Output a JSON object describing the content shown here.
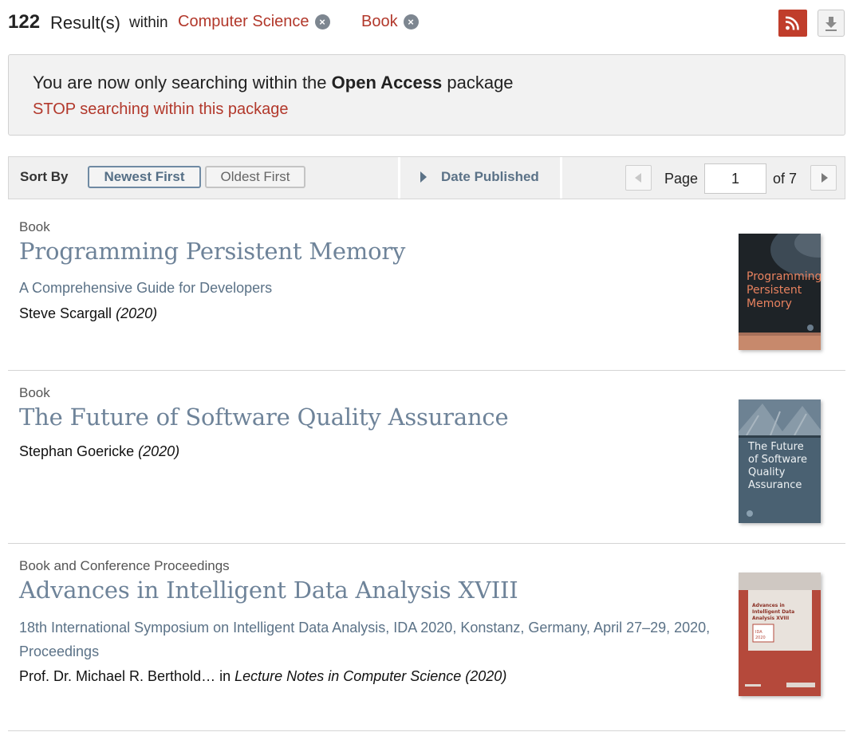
{
  "header": {
    "count": "122",
    "results_label": "Result(s)",
    "within_label": "within",
    "facets": [
      {
        "label": "Computer Science"
      },
      {
        "label": "Book"
      }
    ],
    "remove_symbol": "×",
    "rss_icon": "rss-icon",
    "download_icon": "download-icon"
  },
  "notice": {
    "prefix": "You are now only searching within the ",
    "package_name": "Open Access",
    "suffix": " package",
    "stop_link": "STOP searching within this package"
  },
  "toolbar": {
    "sort_label": "Sort By",
    "newest": "Newest First",
    "oldest": "Oldest First",
    "date_published": "Date Published",
    "page_label": "Page",
    "page_value": "1",
    "page_of": "of 7"
  },
  "results": [
    {
      "type": "Book",
      "title": "Programming Persistent Memory",
      "subtitle": "A Comprehensive Guide for Developers",
      "authors": "Steve Scargall",
      "year": "(2020)",
      "cover_text": "Programming Persistent Memory"
    },
    {
      "type": "Book",
      "title": "The Future of Software Quality Assurance",
      "authors": "Stephan Goericke",
      "year": "(2020)",
      "cover_text": "The Future of Software Quality Assurance"
    },
    {
      "type": "Book and Conference Proceedings",
      "title": "Advances in Intelligent Data Analysis XVIII",
      "subtitle": "18th International Symposium on Intelligent Data Analysis, IDA 2020, Konstanz, Germany, April 27–29, 2020, Proceedings",
      "authors": "Prof. Dr. Michael R. Berthold…",
      "in_label": "in",
      "series": "Lecture Notes in Computer Science (2020)",
      "cover_text": "Advances in Intelligent Data Analysis XVIII",
      "cover_badge": "IDA 2020"
    }
  ],
  "colors": {
    "accent_red": "#b2382b",
    "link_blue": "#6e8399",
    "rss_red": "#c03d2b"
  }
}
